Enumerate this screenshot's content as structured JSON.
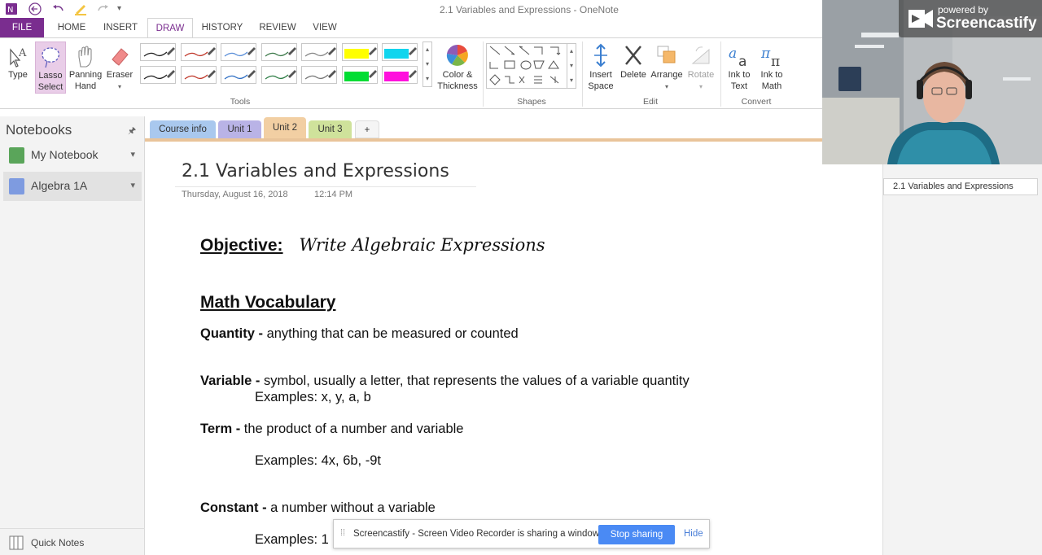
{
  "window": {
    "title": "2.1 Variables and Expressions - OneNote"
  },
  "ribbon_tabs": [
    "FILE",
    "HOME",
    "INSERT",
    "DRAW",
    "HISTORY",
    "REVIEW",
    "VIEW"
  ],
  "ribbon": {
    "type": "Type",
    "lasso_line1": "Lasso",
    "lasso_line2": "Select",
    "panning_line1": "Panning",
    "panning_line2": "Hand",
    "eraser": "Eraser",
    "color_line1": "Color &",
    "color_line2": "Thickness",
    "insert_space_line1": "Insert",
    "insert_space_line2": "Space",
    "delete": "Delete",
    "arrange": "Arrange",
    "rotate": "Rotate",
    "ink_text_line1": "Ink to",
    "ink_text_line2": "Text",
    "ink_math_line1": "Ink to",
    "ink_math_line2": "Math",
    "groups": {
      "tools": "Tools",
      "shapes": "Shapes",
      "edit": "Edit",
      "convert": "Convert"
    },
    "pens": [
      {
        "color": "#222222"
      },
      {
        "color": "#c0392b"
      },
      {
        "color": "#5b8fd9"
      },
      {
        "color": "#3d7a4a"
      },
      {
        "color": "#888888"
      },
      {
        "color": "#ffff00",
        "highlighter": true
      },
      {
        "color": "#11d5ee",
        "highlighter": true
      },
      {
        "color": "#222222"
      },
      {
        "color": "#c0392b"
      },
      {
        "color": "#2f6fc4"
      },
      {
        "color": "#2e7d45"
      },
      {
        "color": "#777777"
      },
      {
        "color": "#00dd33",
        "highlighter": true
      },
      {
        "color": "#ff11dd",
        "highlighter": true
      }
    ]
  },
  "notebooks": {
    "title": "Notebooks",
    "items": [
      {
        "label": "My Notebook",
        "color": "#5aa55a"
      },
      {
        "label": "Algebra 1A",
        "color": "#7e9be0"
      }
    ],
    "quick_notes": "Quick Notes"
  },
  "sections": [
    {
      "label": "Course info",
      "color": "#a9c8ee"
    },
    {
      "label": "Unit 1",
      "color": "#b9b3e6"
    },
    {
      "label": "Unit 2",
      "color": "#f2cfa3"
    },
    {
      "label": "Unit 3",
      "color": "#cfe29b"
    },
    {
      "label": "+",
      "color": "#f5f5f5"
    }
  ],
  "page": {
    "title": "2.1 Variables and Expressions",
    "date": "Thursday, August 16, 2018",
    "time": "12:14 PM",
    "objective_label": "Objective:",
    "objective_text": "Write Algebraic Expressions",
    "vocab_heading": "Math Vocabulary",
    "quantity_term": "Quantity -",
    "quantity_def": " anything that can be measured or counted",
    "variable_term": "Variable -",
    "variable_def": " symbol, usually a letter, that represents the values of a variable quantity",
    "variable_examples": "Examples: x, y, a, b",
    "term_term": "Term -",
    "term_def": " the product of a number and variable",
    "term_examples": "Examples: 4x, 6b, -9t",
    "constant_term": "Constant -",
    "constant_def": " a number without a variable",
    "constant_examples": "Examples: 1"
  },
  "page_list": {
    "selected": "2.1 Variables and Expressions"
  },
  "webcam": {
    "badge_top": "powered by",
    "badge_brand": "Screencastify"
  },
  "share_bar": {
    "text": "Screencastify - Screen Video Recorder is sharing a window.",
    "stop": "Stop sharing",
    "hide": "Hide"
  }
}
